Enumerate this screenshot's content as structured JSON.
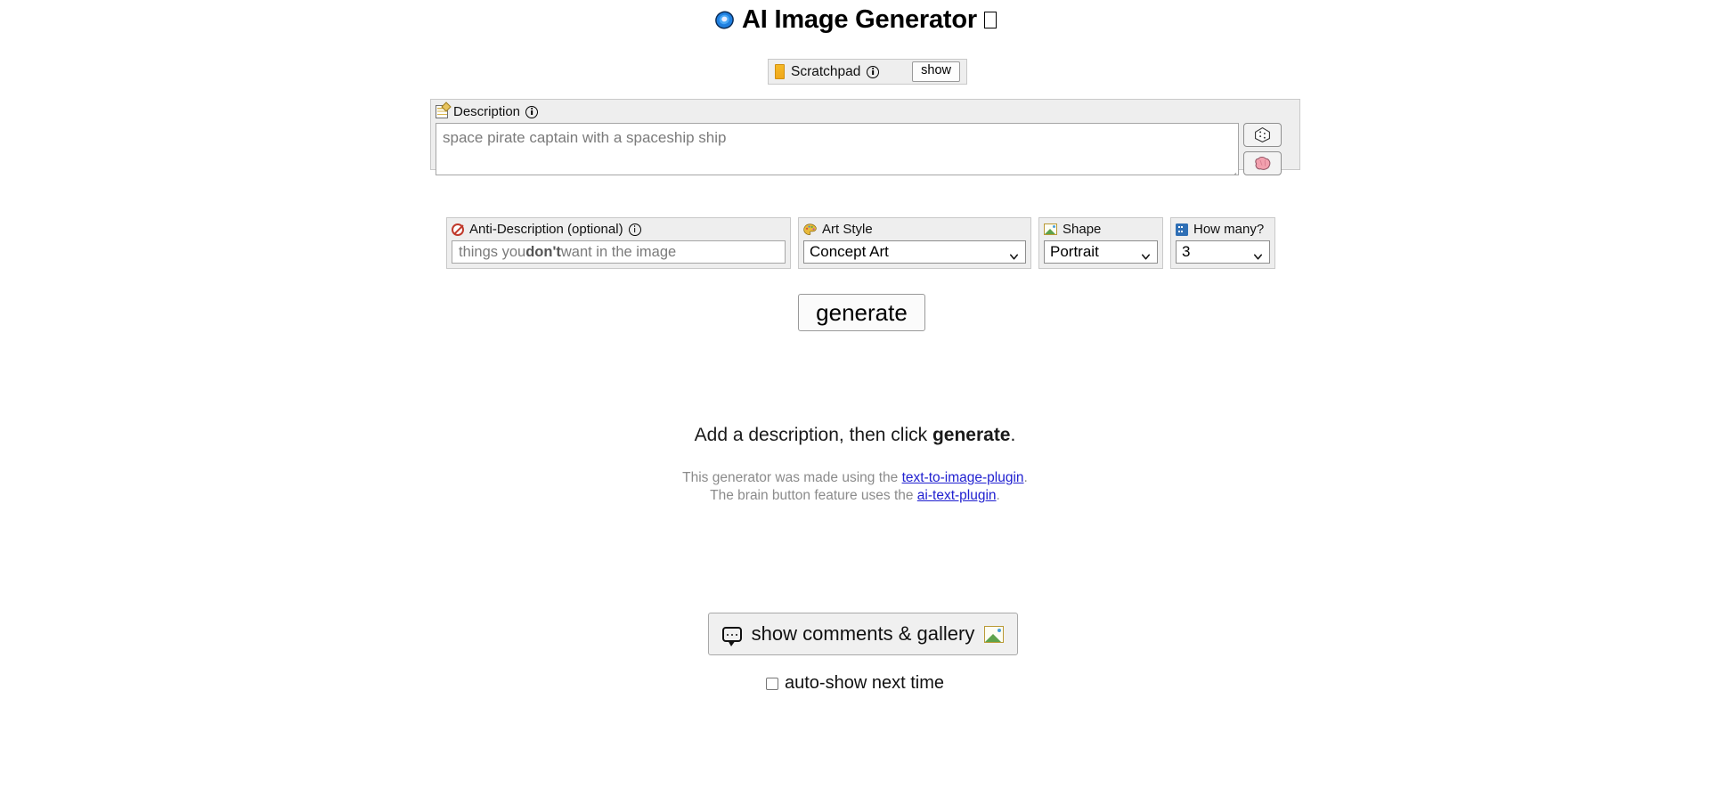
{
  "header": {
    "title": "AI Image Generator",
    "icon": "spiral-icon",
    "trailing_glyph_icon": "missing-glyph-box"
  },
  "scratchpad": {
    "icon": "note-icon",
    "label": "Scratchpad",
    "info_icon": "info-icon",
    "toggle_label": "show"
  },
  "description": {
    "icon": "memo-icon",
    "label": "Description",
    "info_icon": "info-icon",
    "value": "",
    "placeholder": "space pirate captain with a spaceship ship",
    "randomize_icon": "dice-icon",
    "brain_icon": "brain-icon"
  },
  "anti_description": {
    "icon": "no-entry-icon",
    "label": "Anti-Description (optional)",
    "info_icon": "info-icon",
    "value": "",
    "placeholder_prefix": "things you ",
    "placeholder_bold": "don't",
    "placeholder_suffix": " want in the image"
  },
  "art_style": {
    "icon": "palette-icon",
    "label": "Art Style",
    "selected": "Concept Art",
    "caret_icon": "chevron-down-icon"
  },
  "shape": {
    "icon": "picture-icon",
    "label": "Shape",
    "selected": "Portrait",
    "caret_icon": "chevron-down-icon"
  },
  "how_many": {
    "icon": "input-numbers-icon",
    "label": "How many?",
    "selected": "3",
    "caret_icon": "chevron-down-icon"
  },
  "generate": {
    "label": "generate"
  },
  "status": {
    "prefix": "Add a description, then click ",
    "bold": "generate",
    "suffix": "."
  },
  "credits": {
    "line1_prefix": "This generator was made using the ",
    "line1_link": "text-to-image-plugin",
    "line1_suffix": ".",
    "line2_prefix": "The brain button feature uses the ",
    "line2_link": "ai-text-plugin",
    "line2_suffix": "."
  },
  "comments": {
    "balloon_icon": "speech-balloon-icon",
    "label": "show comments & gallery",
    "gallery_icon": "picture-icon"
  },
  "autoshow": {
    "checked": false,
    "label": "auto-show next time"
  },
  "colors": {
    "panel_bg": "#eeeeee",
    "panel_border": "#c9c9c9",
    "link": "#2020d0",
    "placeholder": "#7b7b7b",
    "credits_text": "#8b8b8b"
  }
}
